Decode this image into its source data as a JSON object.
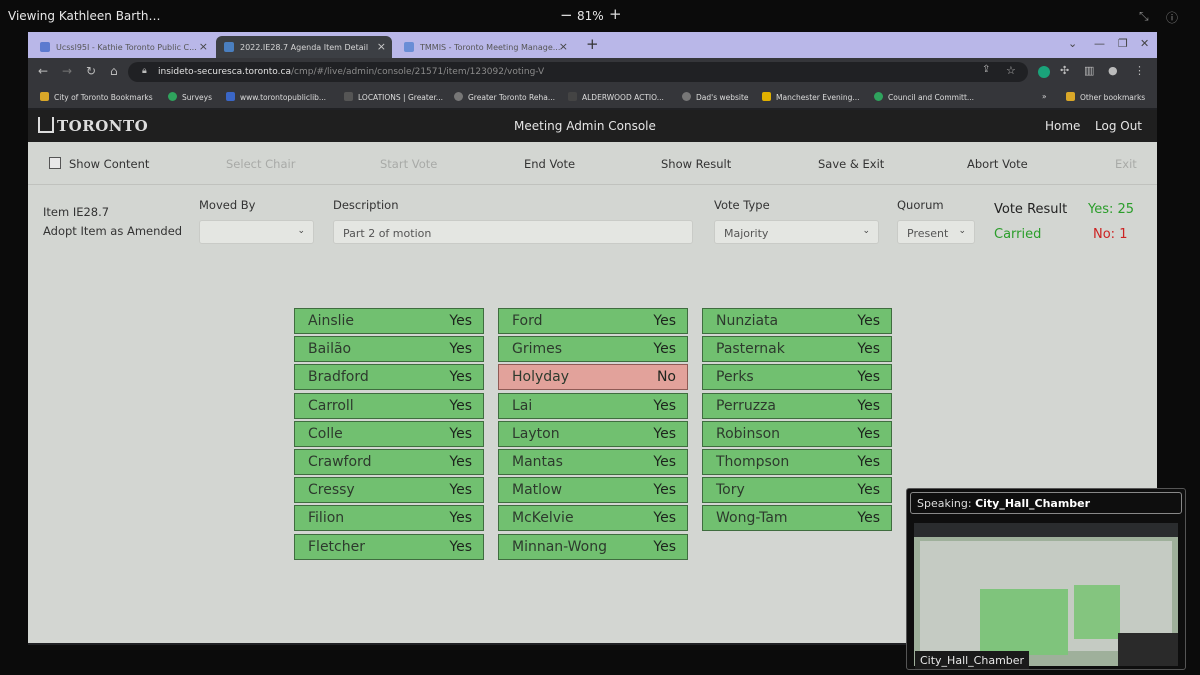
{
  "viewer": {
    "title": "Viewing Kathleen Barth…",
    "zoom": "81%",
    "zoom_minus": "−",
    "zoom_plus": "+"
  },
  "browser": {
    "tabs": [
      {
        "label": "Ucssl95I - Kathie Toronto Public C...",
        "active": false,
        "icon": "globe-icon"
      },
      {
        "label": "2022.IE28.7 Agenda Item Detail",
        "active": true,
        "icon": "toronto-icon"
      },
      {
        "label": "TMMIS - Toronto Meeting Manage...",
        "active": false,
        "icon": "toronto-icon"
      }
    ],
    "new_tab": "+",
    "url_host": "insideto-securesca.toronto.ca",
    "url_path": "/cmp/#/live/admin/console/21571/item/123092/voting-V",
    "bookmarks": [
      "City of Toronto Bookmarks",
      "Surveys",
      "www.torontopubliclib...",
      "LOCATIONS | Greater...",
      "Greater Toronto Reha...",
      "ALDERWOOD ACTIO...",
      "Dad's website",
      "Manchester Evening...",
      "Council and Committ...",
      "»",
      "Other bookmarks"
    ]
  },
  "app": {
    "logo": "TORONTO",
    "title": "Meeting Admin Console",
    "nav": {
      "home": "Home",
      "logout": "Log Out"
    },
    "toolbar": {
      "show_content": "Show Content",
      "select_chair": "Select Chair",
      "start_vote": "Start Vote",
      "end_vote": "End Vote",
      "show_result": "Show Result",
      "save_exit": "Save & Exit",
      "abort_vote": "Abort Vote",
      "exit": "Exit"
    },
    "item": {
      "id": "Item IE28.7",
      "action": "Adopt Item as Amended",
      "moved_by_label": "Moved By",
      "moved_by_value": "",
      "description_label": "Description",
      "description_value": "Part 2 of motion",
      "vote_type_label": "Vote Type",
      "vote_type_value": "Majority",
      "quorum_label": "Quorum",
      "quorum_value": "Present"
    },
    "result": {
      "title": "Vote Result",
      "yes": "Yes: 25",
      "status": "Carried",
      "no": "No: 1"
    },
    "columns": [
      [
        {
          "name": "Ainslie",
          "vote": "Yes"
        },
        {
          "name": "Bailão",
          "vote": "Yes"
        },
        {
          "name": "Bradford",
          "vote": "Yes"
        },
        {
          "name": "Carroll",
          "vote": "Yes"
        },
        {
          "name": "Colle",
          "vote": "Yes"
        },
        {
          "name": "Crawford",
          "vote": "Yes"
        },
        {
          "name": "Cressy",
          "vote": "Yes"
        },
        {
          "name": "Filion",
          "vote": "Yes"
        },
        {
          "name": "Fletcher",
          "vote": "Yes"
        }
      ],
      [
        {
          "name": "Ford",
          "vote": "Yes"
        },
        {
          "name": "Grimes",
          "vote": "Yes"
        },
        {
          "name": "Holyday",
          "vote": "No"
        },
        {
          "name": "Lai",
          "vote": "Yes"
        },
        {
          "name": "Layton",
          "vote": "Yes"
        },
        {
          "name": "Mantas",
          "vote": "Yes"
        },
        {
          "name": "Matlow",
          "vote": "Yes"
        },
        {
          "name": "McKelvie",
          "vote": "Yes"
        },
        {
          "name": "Minnan-Wong",
          "vote": "Yes"
        }
      ],
      [
        {
          "name": "Nunziata",
          "vote": "Yes"
        },
        {
          "name": "Pasternak",
          "vote": "Yes"
        },
        {
          "name": "Perks",
          "vote": "Yes"
        },
        {
          "name": "Perruzza",
          "vote": "Yes"
        },
        {
          "name": "Robinson",
          "vote": "Yes"
        },
        {
          "name": "Thompson",
          "vote": "Yes"
        },
        {
          "name": "Tory",
          "vote": "Yes"
        },
        {
          "name": "Wong-Tam",
          "vote": "Yes"
        }
      ]
    ]
  },
  "speaker": {
    "prefix": "Speaking:",
    "name": "City_Hall_Chamber",
    "label": "City_Hall_Chamber"
  },
  "colors": {
    "yes": "#71c070",
    "no": "#e2a29b",
    "carried": "#2a9d2a",
    "no_count": "#cc2222"
  }
}
